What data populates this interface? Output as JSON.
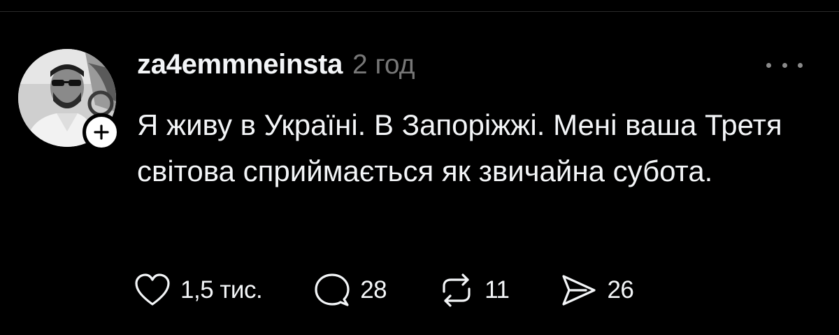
{
  "post": {
    "username": "za4emmneinsta",
    "timestamp": "2 год",
    "text": "Я живу в Україні. В Запоріжжі. Мені ваша Третя світова сприймається як звичайна субота."
  },
  "actions": {
    "likes": "1,5 тис.",
    "replies": "28",
    "reposts": "11",
    "shares": "26"
  },
  "icons": {
    "follow": "plus-icon",
    "more": "more-horizontal-icon",
    "like": "heart-icon",
    "reply": "comment-bubble-icon",
    "repost": "repost-arrows-icon",
    "share": "send-icon"
  },
  "colors": {
    "background": "#000000",
    "text": "#f3f5f7",
    "secondary_text": "#777777"
  }
}
